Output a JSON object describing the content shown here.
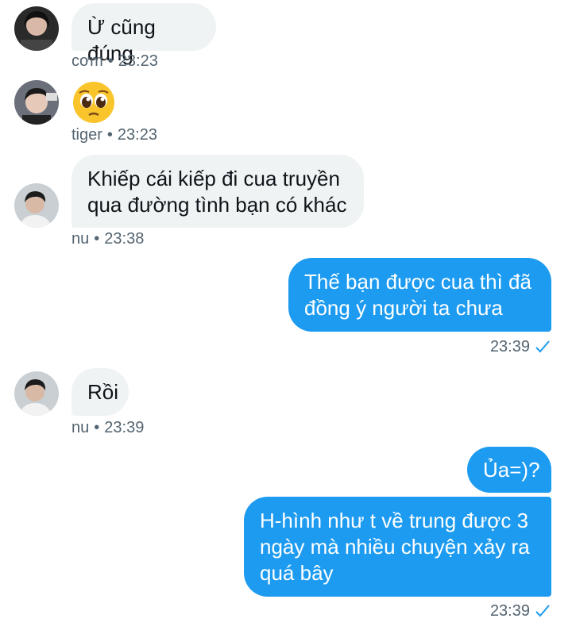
{
  "messages": [
    {
      "text": "Ừ cũng đúng",
      "sender": "cơm",
      "time": "23:23"
    },
    {
      "emoji": "pleading-face",
      "sender": "tiger",
      "time": "23:23"
    },
    {
      "line1": "Khiếp cái kiếp đi cua truyền",
      "line2": "qua đường tình bạn có khác",
      "sender": "nu",
      "time": "23:38"
    },
    {
      "line1": "Thế bạn được cua thì đã",
      "line2": "đồng ý người ta chưa",
      "time": "23:39",
      "read": true
    },
    {
      "text": "Rồi",
      "sender": "nu",
      "time": "23:39"
    },
    {
      "text": "Ủa=)?"
    },
    {
      "line1": "H-hình như t về trung được 3",
      "line2": "ngày mà nhiều chuyện xảy ra",
      "line3": "quá bây",
      "time": "23:39",
      "read": true
    }
  ],
  "colors": {
    "outgoing": "#1d9bf0",
    "incoming": "#eff3f4",
    "meta": "#536471"
  },
  "sep": "•"
}
